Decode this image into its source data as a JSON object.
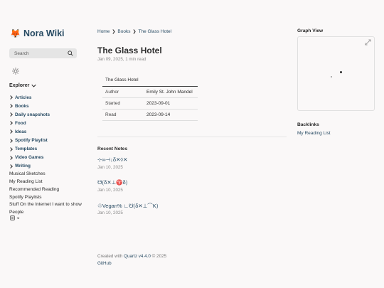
{
  "site": {
    "title": "Nora Wiki"
  },
  "search": {
    "placeholder": "Search"
  },
  "explorer": {
    "label": "Explorer",
    "folders": [
      "Articles",
      "Books",
      "Daily snapshots",
      "Food",
      "Ideas",
      "Spotify Playlist",
      "Templates",
      "Video Games",
      "Writing"
    ],
    "files": [
      "Musical Sketches",
      "My Reading List",
      "Recommended Reading",
      "Spotify Playlists",
      "Stuff On the Internet I want to show",
      "People"
    ]
  },
  "breadcrumb": {
    "items": [
      "Home",
      "Books",
      "The Glass Hotel"
    ],
    "sep": "❯"
  },
  "page": {
    "title": "The Glass Hotel",
    "meta": "Jan 09, 2025, 1 min read",
    "table": {
      "header": "The Glass Hotel",
      "rows": [
        {
          "k": "Author",
          "v": "Emily St. John Mandel"
        },
        {
          "k": "Started",
          "v": "2023-09-01"
        },
        {
          "k": "Read",
          "v": "2023-09-14"
        }
      ]
    }
  },
  "recent": {
    "label": "Recent Notes",
    "items": [
      {
        "title": "⊹∞⊣↓δ✕◊✕",
        "date": "Jan 10, 2025"
      },
      {
        "title": "☋⟮δ✕⊥♈δ⟯",
        "date": "Jan 10, 2025"
      },
      {
        "title": "♲Vegan% ∟☋⟮δ✕⊥⌒K⟯",
        "date": "Jan 10, 2025"
      }
    ]
  },
  "footer": {
    "created": "Created with",
    "quartz": "Quartz v4.4.0",
    "year": "© 2025",
    "github": "GitHub"
  },
  "graph": {
    "label": "Graph View"
  },
  "backlinks": {
    "label": "Backlinks",
    "items": [
      "My Reading List"
    ]
  },
  "colors": {
    "link": "#284b63",
    "accent_fox": "#e8742b",
    "bg": "#faf8f8"
  }
}
